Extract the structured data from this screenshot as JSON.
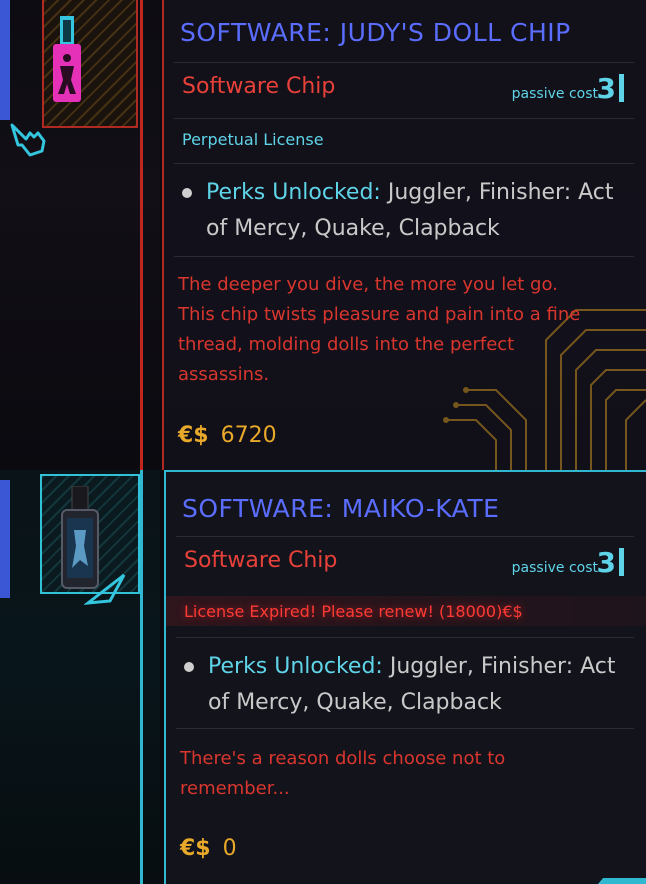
{
  "panels": [
    {
      "title": "SOFTWARE: JUDY'S DOLL CHIP",
      "type_label": "Software Chip",
      "cost_label": "passive cost",
      "cost_value": "3",
      "license": "Perpetual License",
      "license_status": "valid",
      "perks_head": "Perks Unlocked:",
      "perks_list": "Juggler, Finisher: Act of Mercy, Quake, Clapback",
      "description": "The deeper you dive, the more you let go. This chip twists pleasure and pain into a fine thread, molding dolls into the perfect assassins.",
      "currency": "€$",
      "price": "6720",
      "accent_color": "#b02a22"
    },
    {
      "title": "SOFTWARE: MAIKO-KATE",
      "type_label": "Software Chip",
      "cost_label": "passive cost",
      "cost_value": "3",
      "license": "License Expired! Please renew! (18000)€$",
      "license_status": "expired",
      "perks_head": "Perks Unlocked:",
      "perks_list": "Juggler, Finisher: Act of Mercy, Quake, Clapback",
      "description": "There's a reason dolls choose not to remember...",
      "currency": "€$",
      "price": "0",
      "accent_color": "#2fb8cf"
    }
  ],
  "icons": {
    "top_chip": "doll-chip-icon",
    "top_cursor": "hand-cursor-icon",
    "bottom_chip": "maiko-chip-icon",
    "bottom_cursor": "triangle-cursor-icon"
  }
}
